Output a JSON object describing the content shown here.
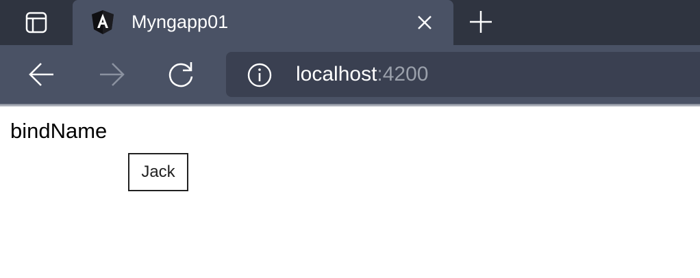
{
  "browser": {
    "tab": {
      "title": "Myngapp01",
      "favicon": "angular-logo-icon"
    },
    "address_bar": {
      "host": "localhost",
      "port": ":4200"
    }
  },
  "page": {
    "label": "bindName",
    "name_value": "Jack"
  },
  "colors": {
    "tabstrip_bg": "#2f3440",
    "active_tab_bg": "#4a5265",
    "address_bg": "#3a4051"
  }
}
